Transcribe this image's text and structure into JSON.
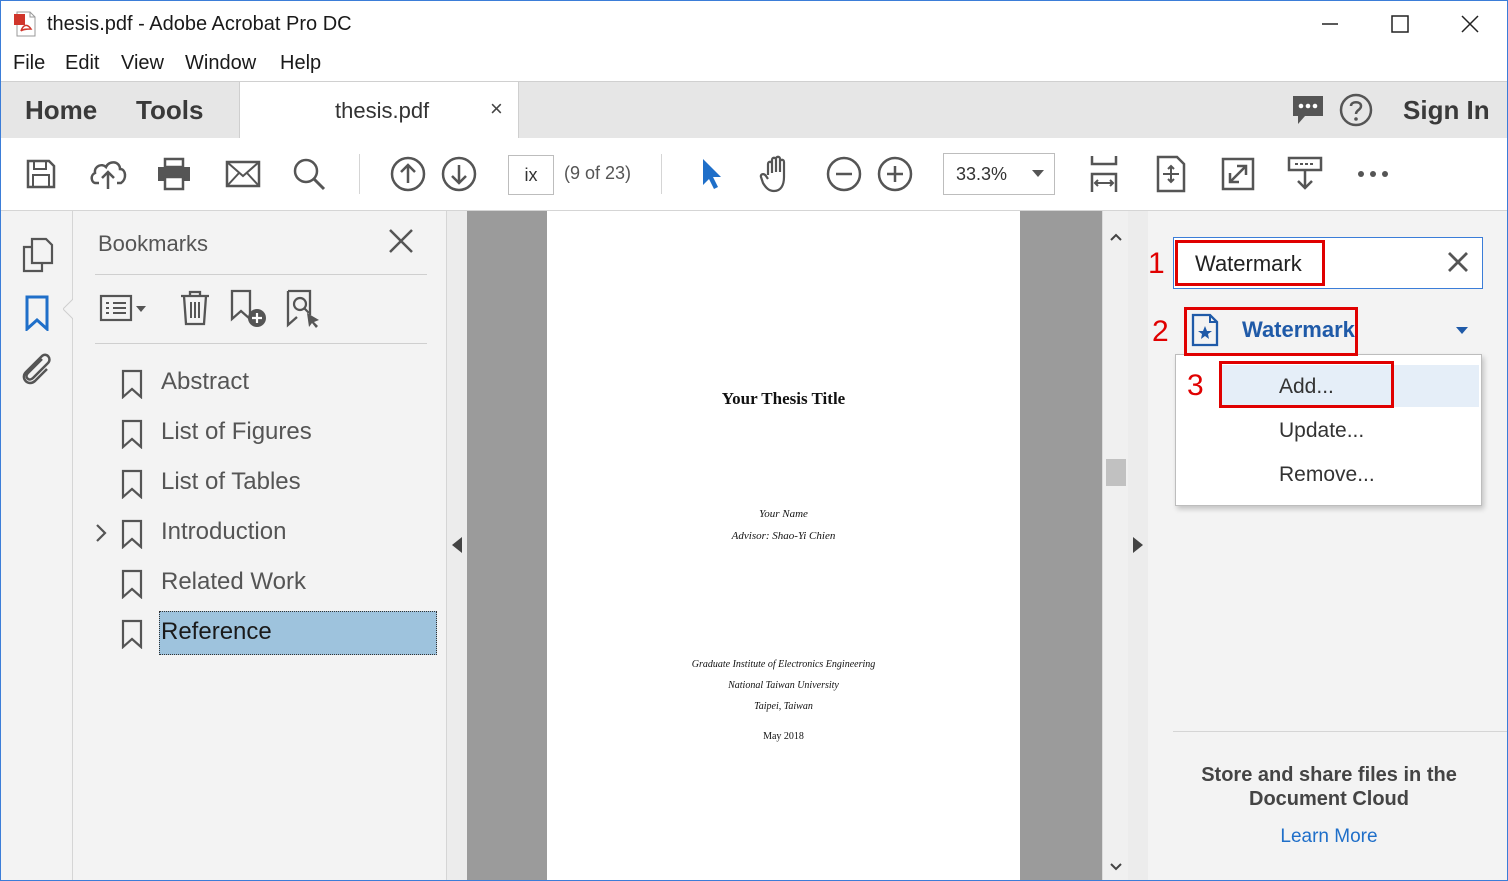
{
  "window": {
    "title": "thesis.pdf - Adobe Acrobat Pro DC",
    "controls": [
      "minimize",
      "maximize",
      "close"
    ]
  },
  "menu": [
    "File",
    "Edit",
    "View",
    "Window",
    "Help"
  ],
  "tabs": {
    "home": "Home",
    "tools": "Tools",
    "document": "thesis.pdf",
    "close": "×",
    "sign_in": "Sign In"
  },
  "toolbar": {
    "page_input": "ix",
    "page_count": "(9 of 23)",
    "zoom": "33.3%",
    "icons": [
      "save-icon",
      "upload-icon",
      "print-icon",
      "email-icon",
      "search-icon",
      "prev-page-icon",
      "next-page-icon",
      "select-pointer-icon",
      "hand-icon",
      "zoom-out-icon",
      "zoom-in-icon",
      "fit-width-icon",
      "fit-page-icon",
      "fullscreen-icon",
      "read-mode-icon",
      "more-icon"
    ]
  },
  "bookmarks": {
    "title": "Bookmarks",
    "items": [
      {
        "label": "Abstract",
        "expandable": false,
        "selected": false
      },
      {
        "label": "List of Figures",
        "expandable": false,
        "selected": false
      },
      {
        "label": "List of Tables",
        "expandable": false,
        "selected": false
      },
      {
        "label": "Introduction",
        "expandable": true,
        "selected": false
      },
      {
        "label": "Related Work",
        "expandable": false,
        "selected": false
      },
      {
        "label": "Reference",
        "expandable": false,
        "selected": true
      }
    ]
  },
  "document_page": {
    "title": "Your Thesis Title",
    "author": "Your Name",
    "advisor": "Advisor: Shao-Yi Chien",
    "institute": "Graduate Institute of Electronics Engineering",
    "university": "National Taiwan University",
    "city": "Taipei, Taiwan",
    "date": "May 2018"
  },
  "right_panel": {
    "search_value": "Watermark",
    "tool_label": "Watermark",
    "menu_items": [
      "Add...",
      "Update...",
      "Remove..."
    ],
    "annotations": [
      "1",
      "2",
      "3"
    ],
    "cloud_text": "Store and share files in the Document Cloud",
    "learn_more": "Learn More"
  },
  "colors": {
    "accent_blue": "#1f5aa8",
    "annotation_red": "#e00000",
    "selection": "#9ec3dd",
    "pdf_icon_red": "#d0352b"
  }
}
